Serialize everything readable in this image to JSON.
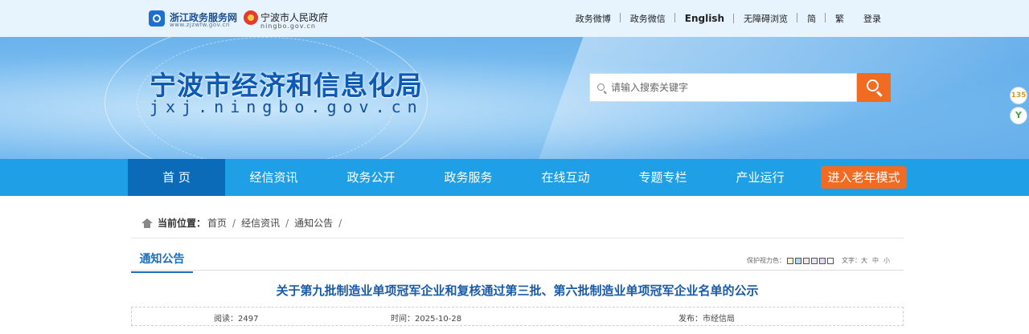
{
  "topbar": {
    "logo1": {
      "name": "浙江政务服务网",
      "url_text": "www.zjzwfw.gov.cn"
    },
    "logo2": {
      "name": "宁波市人民政府",
      "url_text": "ningbo.gov.cn"
    },
    "links": [
      "政务微博",
      "政务微信",
      "English",
      "无障碍浏览",
      "简",
      "繁",
      "登录"
    ]
  },
  "banner": {
    "title": "宁波市经济和信息化局",
    "domain": "jxj.ningbo.gov.cn",
    "search_placeholder": "请输入搜索关键字"
  },
  "floating": {
    "badge1": "135",
    "badge2": "Y"
  },
  "nav": {
    "items": [
      "首 页",
      "经信资讯",
      "政务公开",
      "政务服务",
      "在线互动",
      "专题专栏",
      "产业运行"
    ],
    "senior_mode": "进入老年模式"
  },
  "breadcrumb": {
    "label": "当前位置：",
    "items": [
      "首页",
      "经信资讯",
      "通知公告"
    ]
  },
  "section": {
    "tab": "通知公告",
    "vision_label": "保护视力色：",
    "vision_colors": [
      "#fafad2",
      "#add8e6",
      "#f0e6e6",
      "#e6e6fa",
      "#e8d5f5",
      "#ffffff"
    ],
    "font_label": "文字：",
    "font_sizes": [
      "大",
      "中",
      "小"
    ]
  },
  "article": {
    "title": "关于第九批制造业单项冠军企业和复核通过第三批、第六批制造业单项冠军企业名单的公示",
    "reads": "阅读：2497",
    "time": "时间：2025-10-28",
    "publisher": "发布：市经信局"
  }
}
